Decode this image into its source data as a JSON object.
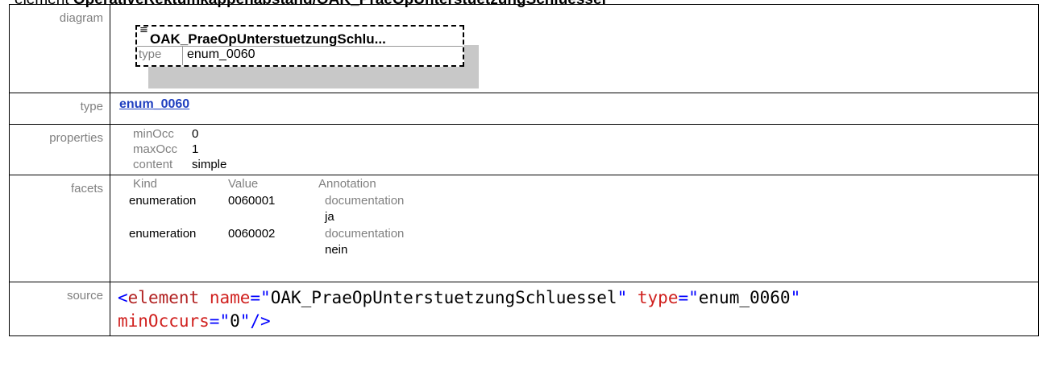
{
  "heading": {
    "label": "element",
    "name": "OperativeRektumkappenabstand/OAK_PraeOpUnterstuetzungSchluessel"
  },
  "rows": {
    "diagram": "diagram",
    "type": "type",
    "properties": "properties",
    "facets": "facets",
    "source": "source"
  },
  "diagram": {
    "title": "OAK_PraeOpUnterstuetzungSchlu...",
    "type_key": "type",
    "type_value": "enum_0060",
    "icon": "element-icon"
  },
  "type_link": "enum_0060",
  "properties": [
    {
      "key": "minOcc",
      "value": "0"
    },
    {
      "key": "maxOcc",
      "value": "1"
    },
    {
      "key": "content",
      "value": "simple"
    }
  ],
  "facets": {
    "headers": {
      "kind": "Kind",
      "value": "Value",
      "annotation": "Annotation"
    },
    "items": [
      {
        "kind": "enumeration",
        "value": "0060001",
        "doc_label": "documentation",
        "doc": "ja"
      },
      {
        "kind": "enumeration",
        "value": "0060002",
        "doc_label": "documentation",
        "doc": "nein"
      }
    ]
  },
  "source": {
    "tag": "element",
    "name_attr": "name",
    "name_value": "OAK_PraeOpUnterstuetzungSchluessel",
    "type_attr": "type",
    "type_value": "enum_0060",
    "min_attr": "minOccurs",
    "min_value": "0"
  }
}
